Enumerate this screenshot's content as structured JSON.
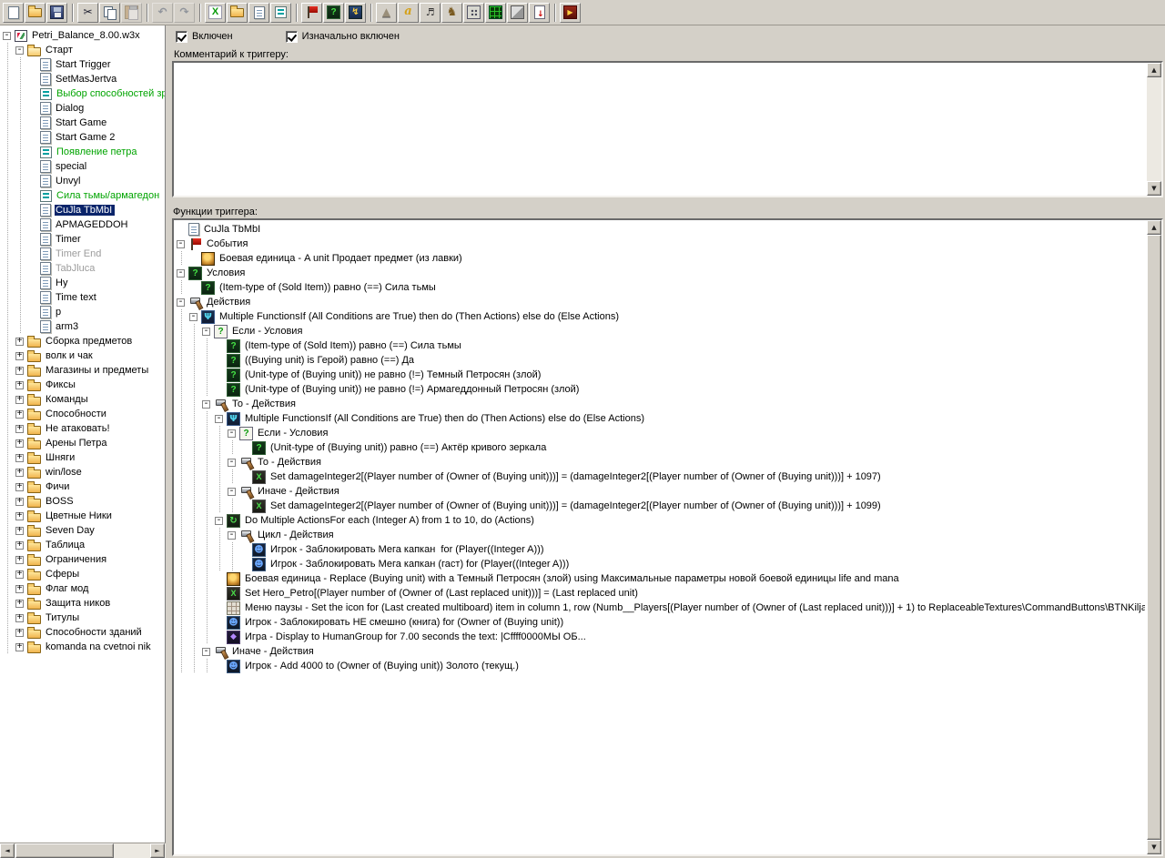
{
  "colors": {
    "selection": "#0a246a",
    "comment_green": "#00a400",
    "disabled_gray": "#9c9c9c",
    "chrome": "#d4d0c8"
  },
  "toolbar": {
    "groups": [
      [
        {
          "i": "new"
        },
        {
          "i": "open"
        },
        {
          "i": "save"
        }
      ],
      [
        {
          "i": "cut"
        },
        {
          "i": "copy"
        },
        {
          "i": "paste",
          "disabled": true
        }
      ],
      [
        {
          "i": "undo",
          "disabled": true
        },
        {
          "i": "redo",
          "disabled": true
        }
      ],
      [
        {
          "i": "export-x"
        },
        {
          "i": "new-category"
        },
        {
          "i": "new-trigger"
        },
        {
          "i": "new-comment"
        }
      ],
      [
        {
          "i": "new-event"
        },
        {
          "i": "new-condition"
        },
        {
          "i": "new-action"
        }
      ],
      [
        {
          "i": "terrain-editor"
        },
        {
          "i": "trigger-editor"
        },
        {
          "i": "sound-editor"
        },
        {
          "i": "object-editor"
        },
        {
          "i": "campaign-editor"
        },
        {
          "i": "ai-editor"
        },
        {
          "i": "object-manager"
        },
        {
          "i": "import-manager"
        }
      ],
      [
        {
          "i": "test-map"
        }
      ]
    ]
  },
  "sidebar": {
    "items": [
      {
        "d": 0,
        "e": "-",
        "i": "map",
        "t": "Petri_Balance_8.00.w3x"
      },
      {
        "d": 1,
        "e": "-",
        "i": "folder-open",
        "t": "Старт"
      },
      {
        "d": 2,
        "i": "trigger",
        "t": "Start Trigger"
      },
      {
        "d": 2,
        "i": "trigger",
        "t": "SetMasJertva"
      },
      {
        "d": 2,
        "i": "comment",
        "t": "Выбор способностей зр",
        "c": "green"
      },
      {
        "d": 2,
        "i": "trigger",
        "t": "Dialog"
      },
      {
        "d": 2,
        "i": "trigger",
        "t": "Start Game"
      },
      {
        "d": 2,
        "i": "trigger",
        "t": "Start Game 2"
      },
      {
        "d": 2,
        "i": "comment",
        "t": "Появление петра",
        "c": "green"
      },
      {
        "d": 2,
        "i": "trigger",
        "t": "special"
      },
      {
        "d": 2,
        "i": "trigger",
        "t": "Unvyl"
      },
      {
        "d": 2,
        "i": "comment",
        "t": "Сила тьмы/армагедон",
        "c": "green"
      },
      {
        "d": 2,
        "i": "trigger",
        "t": "CuJla TbMbI",
        "c": "sel"
      },
      {
        "d": 2,
        "i": "trigger",
        "t": "APMAGEDDOH"
      },
      {
        "d": 2,
        "i": "trigger",
        "t": "Timer"
      },
      {
        "d": 2,
        "i": "trigger",
        "t": "Timer End",
        "c": "gray"
      },
      {
        "d": 2,
        "i": "trigger",
        "t": "TabJluca",
        "c": "gray"
      },
      {
        "d": 2,
        "i": "trigger",
        "t": "Hy"
      },
      {
        "d": 2,
        "i": "trigger",
        "t": "Time text"
      },
      {
        "d": 2,
        "i": "trigger",
        "t": "p"
      },
      {
        "d": 2,
        "i": "trigger",
        "t": "arm3"
      },
      {
        "d": 1,
        "e": "+",
        "i": "folder",
        "t": "Сборка предметов"
      },
      {
        "d": 1,
        "e": "+",
        "i": "folder",
        "t": "волк и чак"
      },
      {
        "d": 1,
        "e": "+",
        "i": "folder",
        "t": "Магазины и предметы"
      },
      {
        "d": 1,
        "e": "+",
        "i": "folder",
        "t": "Фиксы"
      },
      {
        "d": 1,
        "e": "+",
        "i": "folder",
        "t": "Команды"
      },
      {
        "d": 1,
        "e": "+",
        "i": "folder",
        "t": "Способности"
      },
      {
        "d": 1,
        "e": "+",
        "i": "folder",
        "t": "Не атаковать!"
      },
      {
        "d": 1,
        "e": "+",
        "i": "folder",
        "t": "Арены Петра"
      },
      {
        "d": 1,
        "e": "+",
        "i": "folder",
        "t": "Шняги"
      },
      {
        "d": 1,
        "e": "+",
        "i": "folder",
        "t": "win/lose"
      },
      {
        "d": 1,
        "e": "+",
        "i": "folder",
        "t": "Фичи"
      },
      {
        "d": 1,
        "e": "+",
        "i": "folder",
        "t": "BOSS"
      },
      {
        "d": 1,
        "e": "+",
        "i": "folder",
        "t": "Цветные Ники"
      },
      {
        "d": 1,
        "e": "+",
        "i": "folder",
        "t": "Seven Day"
      },
      {
        "d": 1,
        "e": "+",
        "i": "folder",
        "t": "Таблица"
      },
      {
        "d": 1,
        "e": "+",
        "i": "folder",
        "t": "Ограничения"
      },
      {
        "d": 1,
        "e": "+",
        "i": "folder",
        "t": "Сферы"
      },
      {
        "d": 1,
        "e": "+",
        "i": "folder",
        "t": "Флаг мод"
      },
      {
        "d": 1,
        "e": "+",
        "i": "folder",
        "t": "Защита ников"
      },
      {
        "d": 1,
        "e": "+",
        "i": "folder",
        "t": "Титулы"
      },
      {
        "d": 1,
        "e": "+",
        "i": "folder",
        "t": "Способности зданий"
      },
      {
        "d": 1,
        "e": "+",
        "i": "folder",
        "t": "komanda na cvetnoi nik"
      }
    ]
  },
  "panel": {
    "enabled_checkbox": {
      "label": "Включен",
      "checked": true
    },
    "initially_on_checkbox": {
      "label": "Изначально включен",
      "checked": true
    },
    "comment_label": "Комментарий к триггеру:",
    "comment_value": "",
    "functions_label": "Функции триггера:"
  },
  "functions": {
    "nodes": [
      {
        "d": 0,
        "i": "trigger",
        "t": "CuJla TbMbI"
      },
      {
        "d": 0,
        "e": "-",
        "i": "flag",
        "t": "События"
      },
      {
        "d": 1,
        "i": "unit",
        "t": "Боевая единица - A unit Продает предмет (из лавки)"
      },
      {
        "d": 0,
        "e": "-",
        "i": "cond",
        "t": "Условия"
      },
      {
        "d": 1,
        "i": "cond",
        "t": "(Item-type of (Sold Item)) равно (==) Сила тьмы"
      },
      {
        "d": 0,
        "e": "-",
        "i": "hammer",
        "t": "Действия"
      },
      {
        "d": 1,
        "e": "-",
        "i": "if",
        "t": "Multiple FunctionsIf (All Conditions are True) then do (Then Actions) else do (Else Actions)"
      },
      {
        "d": 2,
        "e": "-",
        "i": "ifcond",
        "t": "Если - Условия"
      },
      {
        "d": 3,
        "i": "cond",
        "t": "(Item-type of (Sold Item)) равно (==) Сила тьмы"
      },
      {
        "d": 3,
        "i": "cond",
        "t": "((Buying unit) is Герой) равно (==) Да"
      },
      {
        "d": 3,
        "i": "cond",
        "t": "(Unit-type of (Buying unit)) не равно (!=) Темный Петросян (злой)"
      },
      {
        "d": 3,
        "i": "cond",
        "t": "(Unit-type of (Buying unit)) не равно (!=) Армагеддонный Петросян (злой)"
      },
      {
        "d": 2,
        "e": "-",
        "i": "hammer",
        "t": "То - Действия"
      },
      {
        "d": 3,
        "e": "-",
        "i": "if",
        "t": "Multiple FunctionsIf (All Conditions are True) then do (Then Actions) else do (Else Actions)"
      },
      {
        "d": 4,
        "e": "-",
        "i": "ifcond",
        "t": "Если - Условия"
      },
      {
        "d": 5,
        "i": "cond",
        "t": "(Unit-type of (Buying unit)) равно (==) Актёр кривого зеркала"
      },
      {
        "d": 4,
        "e": "-",
        "i": "hammer",
        "t": "То - Действия"
      },
      {
        "d": 5,
        "i": "setvar",
        "t": "Set damageInteger2[(Player number of (Owner of (Buying unit)))] = (damageInteger2[(Player number of (Owner of (Buying unit)))] + 1097)"
      },
      {
        "d": 4,
        "e": "-",
        "i": "hammer",
        "t": "Иначе - Действия"
      },
      {
        "d": 5,
        "i": "setvar",
        "t": "Set damageInteger2[(Player number of (Owner of (Buying unit)))] = (damageInteger2[(Player number of (Owner of (Buying unit)))] + 1099)"
      },
      {
        "d": 3,
        "e": "-",
        "i": "loop",
        "t": "Do Multiple ActionsFor each (Integer A) from 1 to 10, do (Actions)"
      },
      {
        "d": 4,
        "e": "-",
        "i": "hammer",
        "t": "Цикл - Действия"
      },
      {
        "d": 5,
        "i": "player",
        "t": "Игрок - Заблокировать Мега капкан  for (Player((Integer A)))"
      },
      {
        "d": 5,
        "i": "player",
        "t": "Игрок - Заблокировать Мега капкан (гаст) for (Player((Integer A)))"
      },
      {
        "d": 3,
        "i": "unit",
        "t": "Боевая единица - Replace (Buying unit) with a Темный Петросян (злой) using Максимальные параметры новой боевой единицы life and mana"
      },
      {
        "d": 3,
        "i": "setvar",
        "t": "Set Hero_Petro[(Player number of (Owner of (Last replaced unit)))] = (Last replaced unit)"
      },
      {
        "d": 3,
        "i": "board",
        "t": "Меню паузы - Set the icon for (Last created multiboard) item in column 1, row (Numb__Players[(Player number of (Owner of (Last replaced unit)))] + 1) to ReplaceableTextures\\CommandButtons\\BTNKiljaedin.blp"
      },
      {
        "d": 3,
        "i": "player",
        "t": "Игрок - Заблокировать НЕ смешно (книга) for (Owner of (Buying unit))"
      },
      {
        "d": 3,
        "i": "game",
        "t": "Игра - Display to HumanGroup for 7.00 seconds the text: |Cffff0000МЫ ОБ..."
      },
      {
        "d": 2,
        "e": "-",
        "i": "hammer",
        "t": "Иначе - Действия"
      },
      {
        "d": 3,
        "i": "player",
        "t": "Игрок - Add 4000 to (Owner of (Buying unit)) Золото (текущ.)"
      }
    ]
  }
}
